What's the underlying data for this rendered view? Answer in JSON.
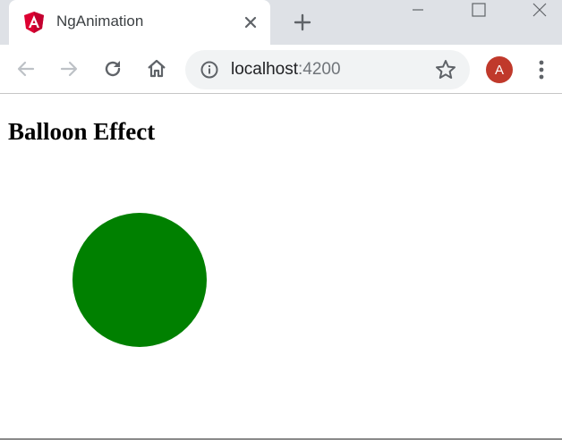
{
  "tab": {
    "title": "NgAnimation",
    "favicon_icon": "angular-logo-icon",
    "close_icon": "close-icon"
  },
  "new_tab_icon": "plus-icon",
  "window_controls": [
    "minimize-icon",
    "maximize-icon",
    "close-window-icon"
  ],
  "toolbar": {
    "back_icon": "arrow-left-icon",
    "forward_icon": "arrow-right-icon",
    "reload_icon": "reload-icon",
    "home_icon": "home-icon",
    "url_host": "localhost",
    "url_port": ":4200",
    "security_icon": "info-icon",
    "bookmark_icon": "star-icon",
    "avatar_initial": "A",
    "menu_icon": "kebab-menu-icon"
  },
  "page": {
    "heading": "Balloon Effect",
    "balloon_color": "#008000"
  },
  "colors": {
    "tabstrip": "#dee1e6",
    "omnibox": "#f1f3f4",
    "avatar": "#c0392b",
    "angular_red": "#dd0031"
  }
}
